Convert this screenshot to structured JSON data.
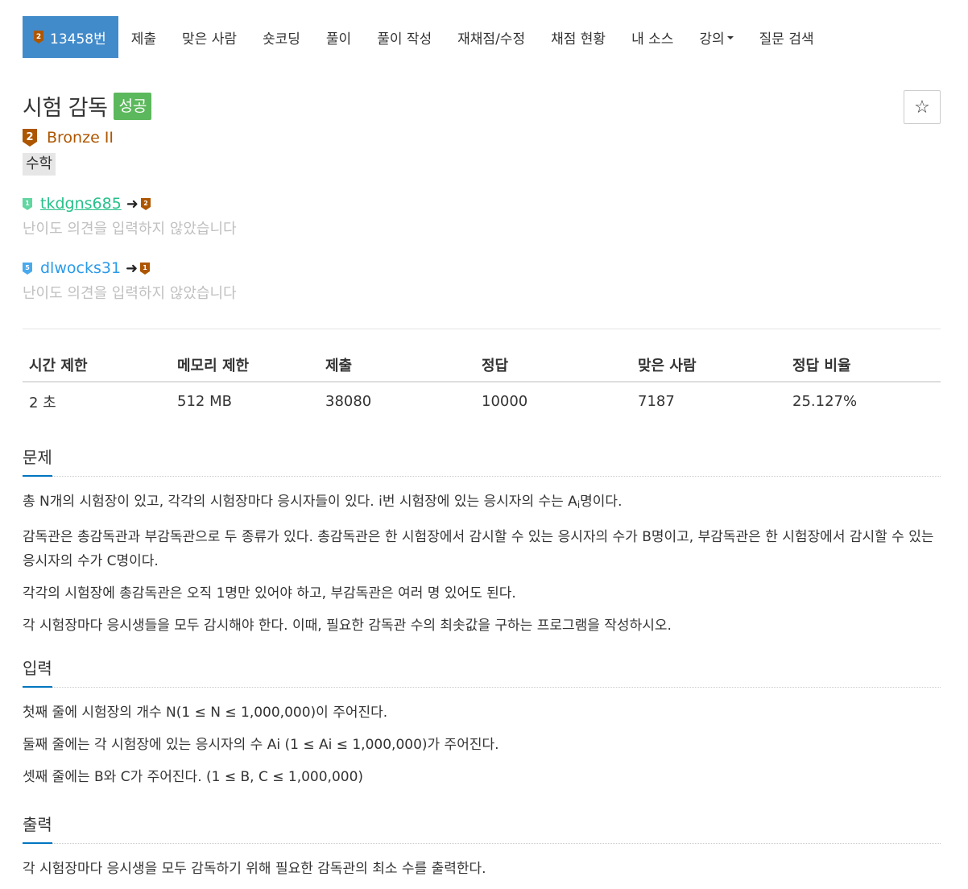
{
  "nav": {
    "tabs": [
      {
        "label": "13458번",
        "tier": "2",
        "active": true
      },
      {
        "label": "제출"
      },
      {
        "label": "맞은 사람"
      },
      {
        "label": "숏코딩"
      },
      {
        "label": "풀이"
      },
      {
        "label": "풀이 작성"
      },
      {
        "label": "재채점/수정"
      },
      {
        "label": "채점 현황"
      },
      {
        "label": "내 소스"
      },
      {
        "label": "강의",
        "dropdown": true
      },
      {
        "label": "질문 검색"
      }
    ]
  },
  "problem": {
    "title": "시험 감독",
    "result_label": "성공",
    "star": "☆",
    "tier_badge": "2",
    "tier_name": "Bronze II",
    "tag": "수학"
  },
  "opinions": [
    {
      "user": "tkdgns685",
      "from_badge": "1",
      "to_badge": "2",
      "from_color": "#61d6a0",
      "user_color": "#27c08a",
      "note": "난이도 의견을 입력하지 않았습니다"
    },
    {
      "user": "dlwocks31",
      "from_badge": "5",
      "to_badge": "1",
      "from_color": "#4aa9ec",
      "user_color": "#2a9ae9",
      "note": "난이도 의견을 입력하지 않았습니다"
    }
  ],
  "stats": {
    "headers": [
      "시간 제한",
      "메모리 제한",
      "제출",
      "정답",
      "맞은 사람",
      "정답 비율"
    ],
    "values": [
      "2 초",
      "512 MB",
      "38080",
      "10000",
      "7187",
      "25.127%"
    ]
  },
  "sections": {
    "problem": {
      "title": "문제",
      "p1_before": "총 N개의 시험장이 있고, 각각의 시험장마다 응시자들이 있다. i번 시험장에 있는 응시자의 수는 A",
      "p1_sub": "i",
      "p1_after": "명이다.",
      "p2": "감독관은 총감독관과 부감독관으로 두 종류가 있다. 총감독관은 한 시험장에서 감시할 수 있는 응시자의 수가 B명이고, 부감독관은 한 시험장에서 감시할 수 있는 응시자의 수가 C명이다.",
      "p3": "각각의 시험장에 총감독관은 오직 1명만 있어야 하고, 부감독관은 여러 명 있어도 된다.",
      "p4": "각 시험장마다 응시생들을 모두 감시해야 한다. 이때, 필요한 감독관 수의 최솟값을 구하는 프로그램을 작성하시오."
    },
    "input": {
      "title": "입력",
      "p1": "첫째 줄에 시험장의 개수 N(1 ≤ N ≤ 1,000,000)이 주어진다.",
      "p2": "둘째 줄에는 각 시험장에 있는 응시자의 수 Ai (1 ≤ Ai ≤ 1,000,000)가 주어진다.",
      "p3": "셋째 줄에는 B와 C가 주어진다. (1 ≤ B, C ≤ 1,000,000)"
    },
    "output": {
      "title": "출력",
      "p1": "각 시험장마다 응시생을 모두 감독하기 위해 필요한 감독관의 최소 수를 출력한다."
    }
  },
  "colors": {
    "bronze": "#ad5600",
    "nav_active": "#428bca",
    "success": "#5cb85c",
    "section_underline": "#0076c0"
  }
}
